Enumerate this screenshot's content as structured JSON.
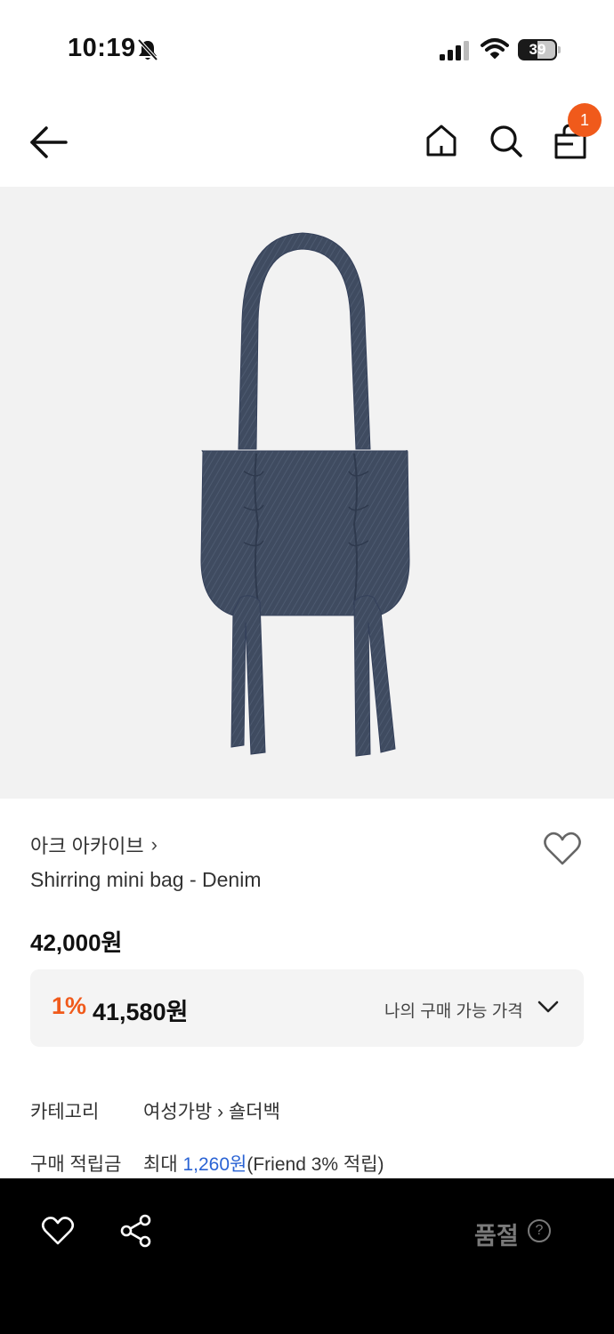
{
  "status_bar": {
    "time": "10:19",
    "battery": "39"
  },
  "header": {
    "cart_count": "1"
  },
  "product": {
    "brand": "아크 아카이브",
    "name": "Shirring mini bag - Denim",
    "price": "42,000원",
    "discount": {
      "percent": "1%",
      "price": "41,580원",
      "label": "나의 구매 가능 가격"
    },
    "info": {
      "category_label": "카테고리",
      "category_main": "여성가방",
      "category_sub": "숄더백",
      "points_label": "구매 적립금",
      "points_prefix": "최대 ",
      "points_value": "1,260원",
      "points_suffix": "(Friend 3% 적립)"
    }
  },
  "bottom_bar": {
    "status": "품절",
    "help_glyph": "?"
  },
  "colors": {
    "accent": "#f05a1b",
    "link": "#2a63d4",
    "image_bg": "#f2f2f2",
    "denim": "#3e4a5e"
  }
}
